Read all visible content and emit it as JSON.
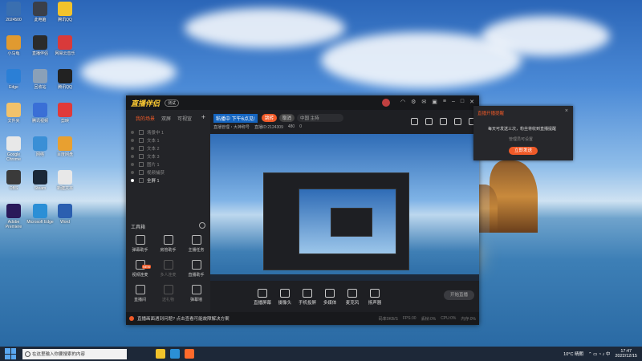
{
  "desktop": {
    "icons": [
      {
        "label": "2024500",
        "color": "#3a6fb0"
      },
      {
        "label": "此电脑",
        "color": "#3a3f4a"
      },
      {
        "label": "腾讯QQ",
        "color": "#f2c32b"
      },
      {
        "label": "小乌龟",
        "color": "#e09a30"
      },
      {
        "label": "直播伴侣",
        "color": "#2b2b2b"
      },
      {
        "label": "网易云音乐",
        "color": "#d93a3a"
      },
      {
        "label": "Edge",
        "color": "#2b7fd6"
      },
      {
        "label": "回收站",
        "color": "#8aa0b8"
      },
      {
        "label": "腾讯QQ",
        "color": "#222"
      },
      {
        "label": "文件夹",
        "color": "#f2c26b"
      },
      {
        "label": "腾讯视频",
        "color": "#3a6fd6"
      },
      {
        "label": "剪映",
        "color": "#e03a3a"
      },
      {
        "label": "Google Chrome",
        "color": "#e8e8e8"
      },
      {
        "label": "网络",
        "color": "#3a8fd6"
      },
      {
        "label": "百度网盘",
        "color": "#e8a030"
      },
      {
        "label": "OBS",
        "color": "#3a3a3a"
      },
      {
        "label": "Steam",
        "color": "#1b2838"
      },
      {
        "label": "新建文本",
        "color": "#e8e8e8"
      },
      {
        "label": "Adobe Premiere",
        "color": "#2a1a5a"
      },
      {
        "label": "Microsoft Edge",
        "color": "#2b8fd6"
      },
      {
        "label": "Word",
        "color": "#2b5fb0"
      }
    ]
  },
  "app": {
    "title": "直播伴侣",
    "version_badge": "测试",
    "window_controls": [
      "minimize",
      "maximize",
      "close"
    ],
    "sidebar": {
      "tabs": [
        "我的场景",
        "双屏",
        "可视宣"
      ],
      "active_tab": 0,
      "sources": [
        {
          "label": "场景中 1",
          "on": false
        },
        {
          "label": "文本 1",
          "on": false
        },
        {
          "label": "文本 2",
          "on": false
        },
        {
          "label": "文本 3",
          "on": false
        },
        {
          "label": "图片 1",
          "on": false
        },
        {
          "label": "视频捕获",
          "on": false
        },
        {
          "label": "全屏 1",
          "on": true
        }
      ],
      "toolbox_title": "工具箱",
      "tools": [
        {
          "label": "弹幕助手",
          "dim": false,
          "new": false
        },
        {
          "label": "房管助手",
          "dim": false,
          "new": false
        },
        {
          "label": "主播任务",
          "dim": false,
          "new": false
        },
        {
          "label": "视频连麦",
          "dim": false,
          "new": true
        },
        {
          "label": "多人连麦",
          "dim": true,
          "new": false
        },
        {
          "label": "直播助手",
          "dim": false,
          "new": false
        },
        {
          "label": "直播间",
          "dim": false,
          "new": false
        },
        {
          "label": "送礼物",
          "dim": true,
          "new": false
        },
        {
          "label": "弹幕墙",
          "dim": false,
          "new": false
        }
      ]
    },
    "header": {
      "live_text": "粘播中 下午6点见!",
      "pill_red": "跳转",
      "pill_gray": "取消",
      "pill_dark": "中国 主持",
      "info": [
        "直播管理・大神称号",
        "直播ID:2124309",
        "480",
        "0"
      ]
    },
    "bottom_buttons": [
      "直播屏幕",
      "摄像头",
      "手机投屏",
      "多媒体",
      "麦克风",
      "扬声器"
    ],
    "start_live_label": "开始直播",
    "status": {
      "message": "直播画面遇到问题? 点击查看可能故障解决方案",
      "stats": [
        "码率0KB/S",
        "FPS:30",
        "丢帧:0%",
        "CPU:0%",
        "内存:0%"
      ]
    }
  },
  "popup": {
    "title": "直播开播提醒",
    "text": "每天可发送三次，粉丝将收到直播提醒",
    "subtext": "管理员可设置",
    "button": "立即发送"
  },
  "taskbar": {
    "search_placeholder": "在这里输入你要搜索的内容",
    "weather": "10°C 晴朗",
    "time": "17:47",
    "date": "2022/12/15",
    "apps": [
      {
        "name": "file-explorer-icon",
        "color": "#f2c32b"
      },
      {
        "name": "edge-icon",
        "color": "#2b8fd6"
      },
      {
        "name": "live-companion-icon",
        "color": "#ff6a2b"
      }
    ]
  }
}
